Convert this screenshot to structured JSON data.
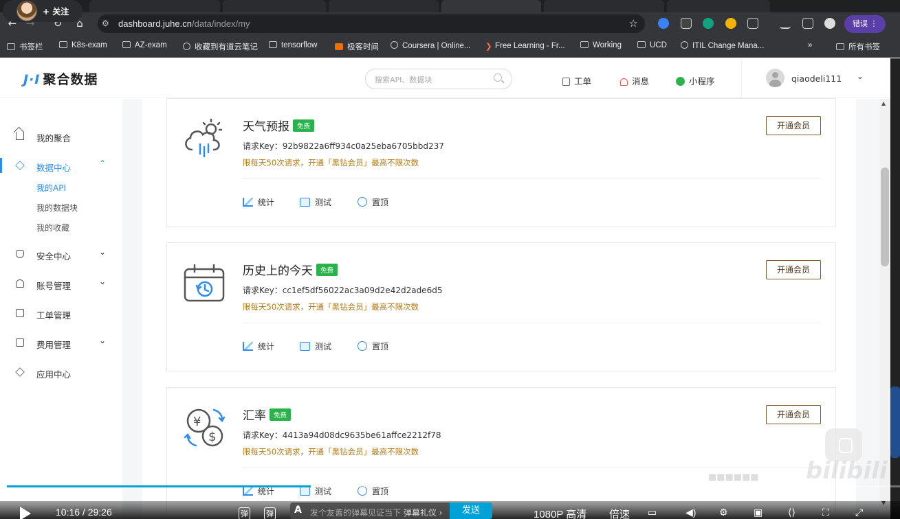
{
  "browser": {
    "follow_label": "+ 关注",
    "url_host": "dashboard.juhe.cn",
    "url_path": "/data/index/my",
    "error_button": "错误 ⋮",
    "bookmarks": [
      {
        "label": "书签栏",
        "icon": "folder"
      },
      {
        "label": "K8s-exam",
        "icon": "folder"
      },
      {
        "label": "AZ-exam",
        "icon": "folder"
      },
      {
        "label": "收藏到有道云笔记",
        "icon": "globe"
      },
      {
        "label": "tensorflow",
        "icon": "folder"
      },
      {
        "label": "极客时间",
        "icon": "red"
      },
      {
        "label": "Coursera | Online...",
        "icon": "globe"
      },
      {
        "label": "Free Learning - Fr...",
        "icon": "orange"
      },
      {
        "label": "Working",
        "icon": "folder"
      },
      {
        "label": "UCD",
        "icon": "folder"
      },
      {
        "label": "ITIL Change Mana...",
        "icon": "globe"
      },
      {
        "label": "»",
        "icon": "none"
      },
      {
        "label": "所有书签",
        "icon": "folder"
      }
    ]
  },
  "header": {
    "logo_mark": "J·I",
    "logo_text": "聚合数据",
    "search_placeholder": "搜索API、数据块",
    "ticket": "工单",
    "messages": "消息",
    "mini_program": "小程序",
    "username": "qiaodeli111",
    "chevron": "⌄"
  },
  "sidebar": {
    "items": [
      {
        "label": "我的聚合",
        "chevron": ""
      },
      {
        "label": "数据中心",
        "chevron": "⌃"
      },
      {
        "label": "安全中心",
        "chevron": "⌄"
      },
      {
        "label": "账号管理",
        "chevron": "⌄"
      },
      {
        "label": "工单管理",
        "chevron": ""
      },
      {
        "label": "费用管理",
        "chevron": "⌄"
      },
      {
        "label": "应用中心",
        "chevron": ""
      }
    ],
    "sub_items": [
      "我的API",
      "我的数据块",
      "我的收藏"
    ]
  },
  "cards": [
    {
      "name": "天气预报",
      "badge": "免费",
      "key": "请求Key：92b9822a6ff934c0a25eba6705bbd237",
      "limit": "限每天50次请求，开通「黑钻会员」最高不限次数",
      "member_button": "开通会员",
      "actions": [
        "统计",
        "测试",
        "置顶"
      ],
      "icon": "weather-icon"
    },
    {
      "name": "历史上的今天",
      "badge": "免费",
      "key": "请求Key：cc1ef5df56022ac3a09d2e42d2ade6d5",
      "limit": "限每天50次请求，开通「黑钻会员」最高不限次数",
      "member_button": "开通会员",
      "actions": [
        "统计",
        "测试",
        "置顶"
      ],
      "icon": "calendar-history-icon"
    },
    {
      "name": "汇率",
      "badge": "免费",
      "key": "请求Key：4413a94d08dc9635be61affce2212f78",
      "limit": "限每天50次请求，开通「黑钻会员」最高不限次数",
      "member_button": "开通会员",
      "actions": [
        "统计",
        "测试",
        "置顶"
      ],
      "icon": "currency-exchange-icon"
    }
  ],
  "player": {
    "time": "10:16 / 29:26",
    "danmu_icon1": "弹",
    "danmu_icon2": "弹",
    "danmu_placeholder": "发个友善的弹幕见证当下",
    "danmu_etiquette": "弹幕礼仪 ›",
    "send": "发送",
    "quality": "1080P 高清",
    "speed": "倍速",
    "watermark": "bilibili",
    "progress": 0.34
  },
  "colors": {
    "accent": "#2d8cf0",
    "free_badge": "#2bb24c",
    "limit_text": "#b07a14",
    "member_border": "#7a5a2b",
    "bili_blue": "#00a1d6"
  }
}
